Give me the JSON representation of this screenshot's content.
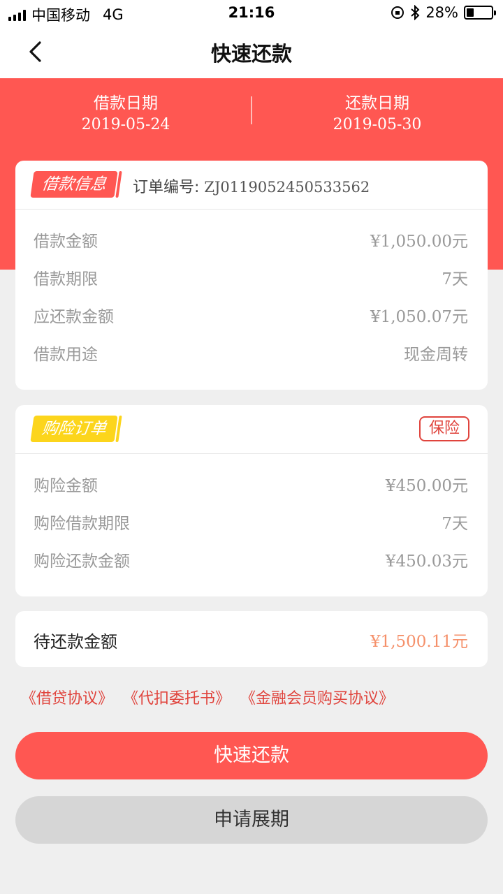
{
  "status_bar": {
    "carrier": "中国移动",
    "network": "4G",
    "time": "21:16",
    "battery": "28%",
    "battery_level": 0.28
  },
  "nav": {
    "title": "快速还款"
  },
  "dates": {
    "loan_label": "借款日期",
    "loan_date": "2019-05-24",
    "repay_label": "还款日期",
    "repay_date": "2019-05-30"
  },
  "loan_card": {
    "tag": "借款信息",
    "order_label": "订单编号:",
    "order_no": "ZJ0119052450533562",
    "rows": [
      {
        "label": "借款金额",
        "value": "¥1,050.00元"
      },
      {
        "label": "借款期限",
        "value": "7天"
      },
      {
        "label": "应还款金额",
        "value": "¥1,050.07元"
      },
      {
        "label": "借款用途",
        "value": "现金周转"
      }
    ]
  },
  "insurance_card": {
    "tag": "购险订单",
    "badge": "保险",
    "rows": [
      {
        "label": "购险金额",
        "value": "¥450.00元"
      },
      {
        "label": "购险借款期限",
        "value": "7天"
      },
      {
        "label": "购险还款金额",
        "value": "¥450.03元"
      }
    ]
  },
  "due": {
    "label": "待还款金额",
    "value": "¥1,500.11元"
  },
  "links": [
    "《借贷协议》",
    "《代扣委托书》",
    "《金融会员购买协议》"
  ],
  "buttons": {
    "primary": "快速还款",
    "secondary": "申请展期"
  },
  "colors": {
    "accent": "#ff5752",
    "tag_yellow": "#fcd51c",
    "due_amount": "#f5906a",
    "link": "#e0443d"
  }
}
